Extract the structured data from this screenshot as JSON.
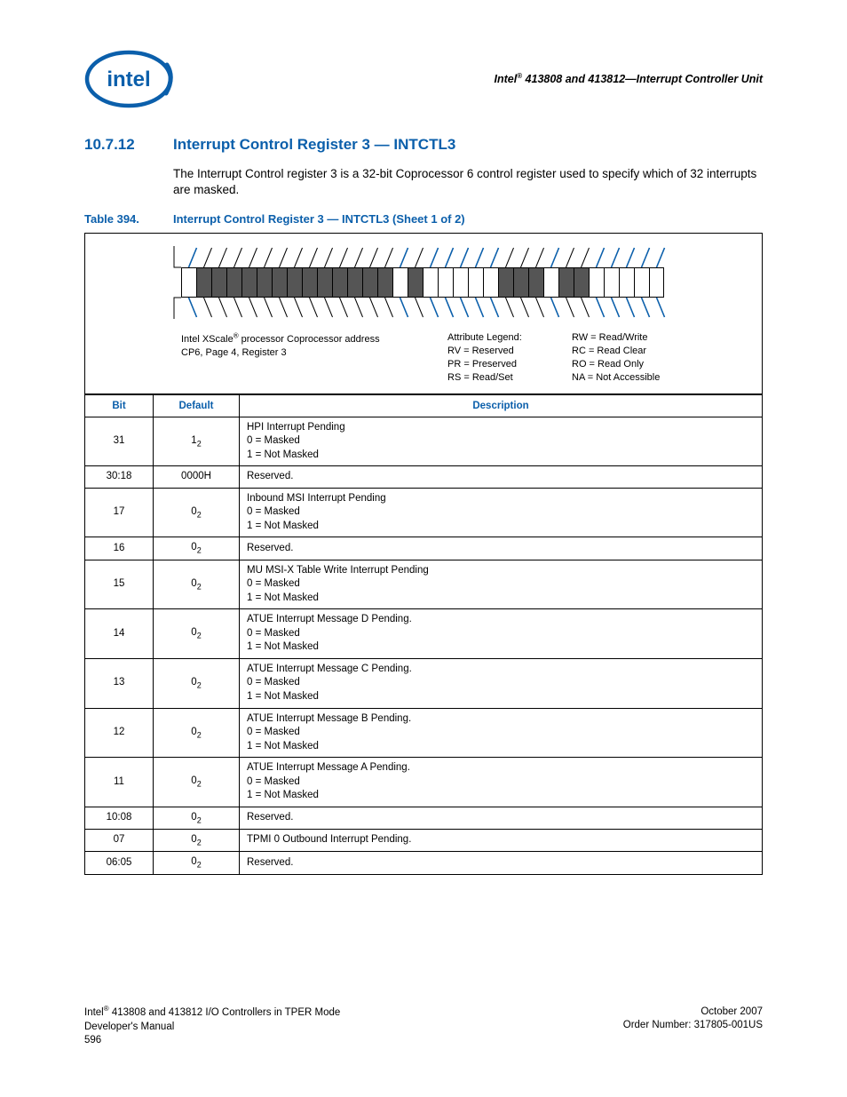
{
  "running_head": "Intel® 413808 and 413812—Interrupt Controller Unit",
  "section": {
    "number": "10.7.12",
    "title": "Interrupt Control Register 3 — INTCTL3"
  },
  "body_para": "The Interrupt Control register 3 is a 32-bit Coprocessor 6 control register used to specify which of 32 interrupts are masked.",
  "table_caption": {
    "label": "Table 394.",
    "title": "Interrupt Control Register 3 — INTCTL3 (Sheet 1 of 2)"
  },
  "bit_diagram": {
    "coproc_line1": "Intel XScale® processor Coprocessor address",
    "coproc_line2": "CP6, Page 4, Register 3",
    "legend_title": "Attribute Legend:",
    "legend": {
      "rv": "RV = Reserved",
      "pr": "PR = Preserved",
      "rs": "RS = Read/Set",
      "rw": "RW = Read/Write",
      "rc": "RC = Read Clear",
      "ro": "RO = Read Only",
      "na": "NA = Not Accessible"
    },
    "reserved_bits": [
      30,
      29,
      28,
      27,
      26,
      25,
      24,
      23,
      22,
      21,
      20,
      19,
      18,
      16,
      10,
      9,
      8,
      6,
      5
    ]
  },
  "columns": {
    "bit": "Bit",
    "default": "Default",
    "description": "Description"
  },
  "rows": [
    {
      "bit": "31",
      "def": "1",
      "def_sub": "2",
      "desc": "HPI Interrupt Pending\n0 =  Masked\n1 =  Not Masked"
    },
    {
      "bit": "30:18",
      "def": "0000H",
      "def_sub": "",
      "desc": "Reserved."
    },
    {
      "bit": "17",
      "def": "0",
      "def_sub": "2",
      "desc": "Inbound MSI Interrupt Pending\n0 =  Masked\n1 =  Not Masked"
    },
    {
      "bit": "16",
      "def": "0",
      "def_sub": "2",
      "desc": "Reserved."
    },
    {
      "bit": "15",
      "def": "0",
      "def_sub": "2",
      "desc": "MU MSI-X Table Write Interrupt Pending\n0 =  Masked\n1 =  Not Masked"
    },
    {
      "bit": "14",
      "def": "0",
      "def_sub": "2",
      "desc": "ATUE Interrupt Message D Pending.\n0 =  Masked\n1 =  Not Masked"
    },
    {
      "bit": "13",
      "def": "0",
      "def_sub": "2",
      "desc": "ATUE Interrupt Message C Pending.\n0 =  Masked\n1 =  Not Masked"
    },
    {
      "bit": "12",
      "def": "0",
      "def_sub": "2",
      "desc": "ATUE Interrupt Message B Pending.\n0 =  Masked\n1 =  Not Masked"
    },
    {
      "bit": "11",
      "def": "0",
      "def_sub": "2",
      "desc": "ATUE Interrupt Message A Pending.\n0 =  Masked\n1 =  Not Masked"
    },
    {
      "bit": "10:08",
      "def": "0",
      "def_sub": "2",
      "desc": "Reserved."
    },
    {
      "bit": "07",
      "def": "0",
      "def_sub": "2",
      "desc": "TPMI 0 Outbound Interrupt Pending."
    },
    {
      "bit": "06:05",
      "def": "0",
      "def_sub": "2",
      "desc": "Reserved."
    }
  ],
  "footer": {
    "left1": "Intel® 413808 and 413812 I/O Controllers in TPER Mode",
    "left2": "Developer's Manual",
    "left3": "596",
    "right1": "October 2007",
    "right2": "Order Number: 317805-001US"
  }
}
